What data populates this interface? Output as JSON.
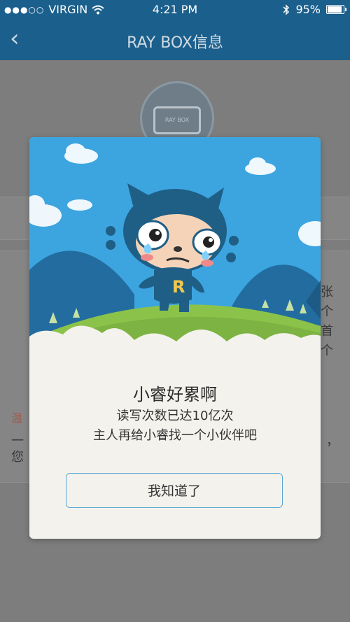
{
  "status_bar": {
    "carrier": "VIRGIN",
    "time": "4:21 PM",
    "battery_percent": "95%",
    "battery_level": 0.95,
    "icons": [
      "signal-dots-icon",
      "wifi-icon",
      "bluetooth-icon",
      "battery-icon"
    ]
  },
  "nav": {
    "title": "RAY BOX信息",
    "back_icon": "back-chevron-icon"
  },
  "background": {
    "device_label": "RAY BOX",
    "side_chars_right": [
      "张",
      "个",
      "首",
      "个"
    ],
    "warn_prefix": "温",
    "left_line1": "一",
    "left_line2": "您",
    "right_fragment": "，"
  },
  "modal": {
    "title": "小睿好累啊",
    "line1": "读写次数已达10亿次",
    "line2": "主人再给小睿找一个小伙伴吧",
    "ok_label": "我知道了",
    "mascot_badge": "R"
  },
  "colors": {
    "nav_bg": "#1b5f8c",
    "sky": "#3ca5e0",
    "hill": "#8bc34a",
    "button_border": "#5ba8d6"
  }
}
